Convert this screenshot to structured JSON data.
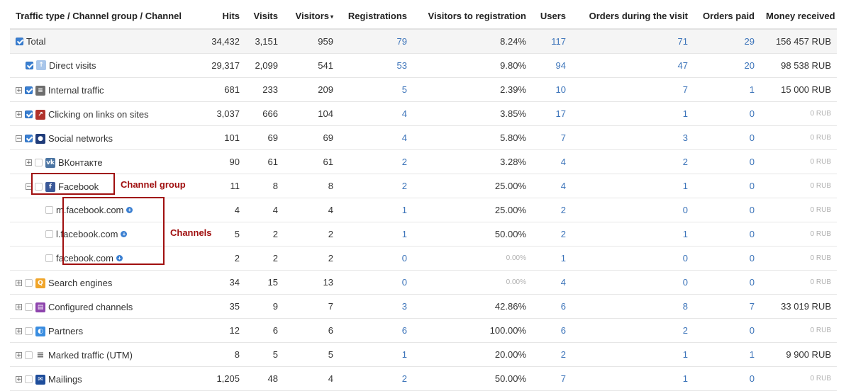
{
  "columns": [
    "Traffic type / Channel group / Channel",
    "Hits",
    "Visits",
    "Visitors",
    "Registrations",
    "Visitors to registration",
    "Users",
    "Orders during the visit",
    "Orders paid",
    "Money received"
  ],
  "sort_indicator": "▾",
  "rows": [
    {
      "name": "Total",
      "hits": "34,432",
      "visits": "3,151",
      "visitors": "959",
      "registrations": "79",
      "v2r": "8.24%",
      "users": "117",
      "orders": "71",
      "paid": "29",
      "money": "156 457 RUB",
      "icon": "none",
      "checked": true,
      "indent": 0,
      "expander": "none",
      "cls": "total"
    },
    {
      "name": "Direct visits",
      "hits": "29,317",
      "visits": "2,099",
      "visitors": "541",
      "registrations": "53",
      "v2r": "9.80%",
      "users": "94",
      "orders": "47",
      "paid": "20",
      "money": "98 538 RUB",
      "icon": "direct-visits-icon",
      "checked": true,
      "indent": 1,
      "expander": "none"
    },
    {
      "name": "Internal traffic",
      "hits": "681",
      "visits": "233",
      "visitors": "209",
      "registrations": "5",
      "v2r": "2.39%",
      "users": "10",
      "orders": "7",
      "paid": "1",
      "money": "15 000 RUB",
      "icon": "internal-traffic-icon",
      "checked": true,
      "indent": 0,
      "expander": "plus"
    },
    {
      "name": "Clicking on links on sites",
      "hits": "3,037",
      "visits": "666",
      "visitors": "104",
      "registrations": "4",
      "v2r": "3.85%",
      "users": "17",
      "orders": "1",
      "paid": "0",
      "money": "0 RUB",
      "icon": "link-icon",
      "checked": true,
      "indent": 0,
      "expander": "plus"
    },
    {
      "name": "Social networks",
      "hits": "101",
      "visits": "69",
      "visitors": "69",
      "registrations": "4",
      "v2r": "5.80%",
      "users": "7",
      "orders": "3",
      "paid": "0",
      "money": "0 RUB",
      "icon": "social-networks-icon",
      "checked": true,
      "indent": 0,
      "expander": "minus"
    },
    {
      "name": "ВКонтакте",
      "hits": "90",
      "visits": "61",
      "visitors": "61",
      "registrations": "2",
      "v2r": "3.28%",
      "users": "4",
      "orders": "2",
      "paid": "0",
      "money": "0 RUB",
      "icon": "vk-icon",
      "checked": false,
      "indent": 1,
      "expander": "plus"
    },
    {
      "name": "Facebook",
      "hits": "11",
      "visits": "8",
      "visitors": "8",
      "registrations": "2",
      "v2r": "25.00%",
      "users": "4",
      "orders": "1",
      "paid": "0",
      "money": "0 RUB",
      "icon": "facebook-icon",
      "checked": false,
      "indent": 1,
      "expander": "minus"
    },
    {
      "name": "m.facebook.com",
      "hits": "4",
      "visits": "4",
      "visitors": "4",
      "registrations": "1",
      "v2r": "25.00%",
      "users": "2",
      "orders": "0",
      "paid": "0",
      "money": "0 RUB",
      "icon": "none",
      "checked": false,
      "indent": 3,
      "expander": "none",
      "add": true
    },
    {
      "name": "l.facebook.com",
      "hits": "5",
      "visits": "2",
      "visitors": "2",
      "registrations": "1",
      "v2r": "50.00%",
      "users": "2",
      "orders": "1",
      "paid": "0",
      "money": "0 RUB",
      "icon": "none",
      "checked": false,
      "indent": 3,
      "expander": "none",
      "add": true
    },
    {
      "name": "facebook.com",
      "hits": "2",
      "visits": "2",
      "visitors": "2",
      "registrations": "0",
      "v2r": "0.00%",
      "users": "1",
      "orders": "0",
      "paid": "0",
      "money": "0 RUB",
      "icon": "none",
      "checked": false,
      "indent": 3,
      "expander": "none",
      "add": true,
      "v2r_muted": true
    },
    {
      "name": "Search engines",
      "hits": "34",
      "visits": "15",
      "visitors": "13",
      "registrations": "0",
      "v2r": "0.00%",
      "users": "4",
      "orders": "0",
      "paid": "0",
      "money": "0 RUB",
      "icon": "search-engines-icon",
      "checked": false,
      "indent": 0,
      "expander": "plus",
      "v2r_muted": true
    },
    {
      "name": "Configured channels",
      "hits": "35",
      "visits": "9",
      "visitors": "7",
      "registrations": "3",
      "v2r": "42.86%",
      "users": "6",
      "orders": "8",
      "paid": "7",
      "money": "33 019 RUB",
      "icon": "configured-channels-icon",
      "checked": false,
      "indent": 0,
      "expander": "plus"
    },
    {
      "name": "Partners",
      "hits": "12",
      "visits": "6",
      "visitors": "6",
      "registrations": "6",
      "v2r": "100.00%",
      "users": "6",
      "orders": "2",
      "paid": "0",
      "money": "0 RUB",
      "icon": "partners-icon",
      "checked": false,
      "indent": 0,
      "expander": "plus"
    },
    {
      "name": "Marked traffic (UTM)",
      "hits": "8",
      "visits": "5",
      "visitors": "5",
      "registrations": "1",
      "v2r": "20.00%",
      "users": "2",
      "orders": "1",
      "paid": "1",
      "money": "9 900 RUB",
      "icon": "utm-list-icon",
      "checked": false,
      "indent": 0,
      "expander": "plus"
    },
    {
      "name": "Mailings",
      "hits": "1,205",
      "visits": "48",
      "visitors": "4",
      "registrations": "2",
      "v2r": "50.00%",
      "users": "7",
      "orders": "1",
      "paid": "0",
      "money": "0 RUB",
      "icon": "mailings-icon",
      "checked": false,
      "indent": 0,
      "expander": "plus"
    }
  ],
  "annotations": {
    "channel_group": "Channel group",
    "channels": "Channels"
  },
  "icon_colors": {
    "direct-visits-icon": "#a9c6ea",
    "internal-traffic-icon": "#6e6e6e",
    "link-icon": "#b1322c",
    "social-networks-icon": "#1f3c7a",
    "vk-icon": "#4c75a3",
    "facebook-icon": "#3b5998",
    "search-engines-icon": "#f0a52a",
    "configured-channels-icon": "#8e44ad",
    "partners-icon": "#3a8de0",
    "utm-list-icon": "#777777",
    "mailings-icon": "#1e4d9b"
  },
  "link_color": "#3b73b9",
  "annotation_color": "#a00f0f"
}
